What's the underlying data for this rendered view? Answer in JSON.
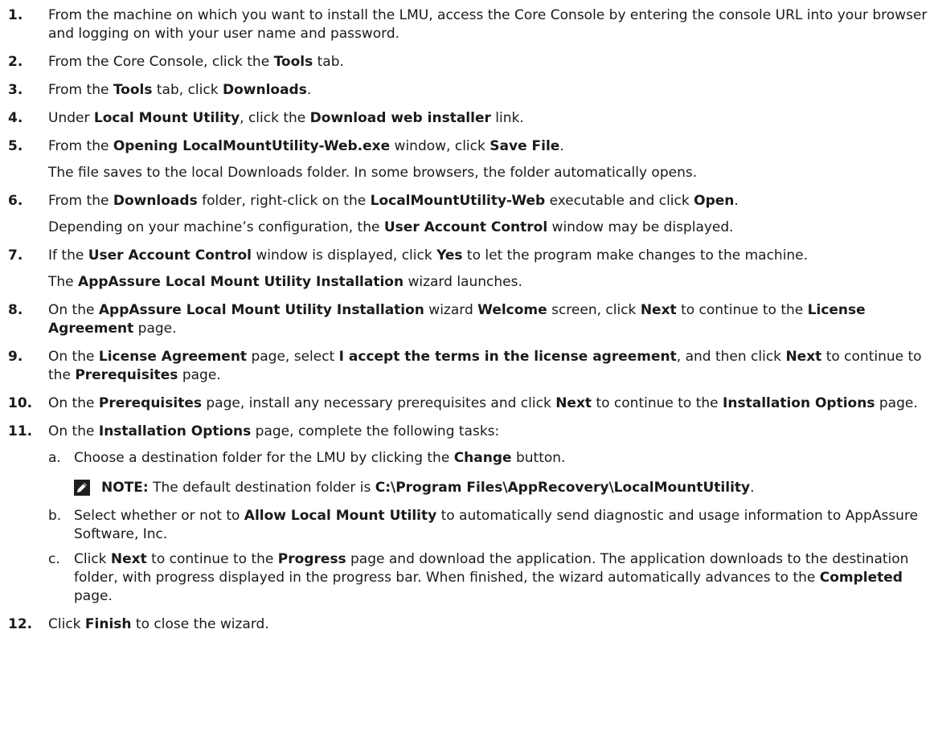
{
  "steps": [
    {
      "number": "1.",
      "parts": [
        {
          "t": "From the machine on which you want to install the LMU, access the Core Console by entering the console URL into your browser and logging on with your user name and password."
        }
      ]
    },
    {
      "number": "2.",
      "parts": [
        {
          "t": "From the Core Console, click the "
        },
        {
          "t": "Tools",
          "b": true
        },
        {
          "t": " tab."
        }
      ]
    },
    {
      "number": "3.",
      "parts": [
        {
          "t": "From the "
        },
        {
          "t": "Tools",
          "b": true
        },
        {
          "t": " tab, click "
        },
        {
          "t": "Downloads",
          "b": true
        },
        {
          "t": "."
        }
      ]
    },
    {
      "number": "4.",
      "parts": [
        {
          "t": "Under "
        },
        {
          "t": "Local Mount Utility",
          "b": true
        },
        {
          "t": ", click the "
        },
        {
          "t": "Download web installer",
          "b": true
        },
        {
          "t": " link."
        }
      ]
    },
    {
      "number": "5.",
      "parts": [
        {
          "t": "From the "
        },
        {
          "t": "Opening LocalMountUtility-Web.exe",
          "b": true
        },
        {
          "t": " window, click "
        },
        {
          "t": "Save File",
          "b": true
        },
        {
          "t": "."
        }
      ],
      "followup": [
        {
          "t": "The file saves to the local Downloads folder. In some browsers, the folder automatically opens."
        }
      ]
    },
    {
      "number": "6.",
      "parts": [
        {
          "t": "From the "
        },
        {
          "t": "Downloads",
          "b": true
        },
        {
          "t": " folder, right-click on the "
        },
        {
          "t": "LocalMountUtility-Web",
          "b": true
        },
        {
          "t": " executable and click "
        },
        {
          "t": "Open",
          "b": true
        },
        {
          "t": "."
        }
      ],
      "followup": [
        {
          "t": "Depending on your machine’s configuration, the "
        },
        {
          "t": "User Account Control",
          "b": true
        },
        {
          "t": " window may be displayed."
        }
      ]
    },
    {
      "number": "7.",
      "parts": [
        {
          "t": "If the "
        },
        {
          "t": "User Account Control",
          "b": true
        },
        {
          "t": " window is displayed, click "
        },
        {
          "t": "Yes",
          "b": true
        },
        {
          "t": " to let the program make changes to the machine."
        }
      ],
      "followup": [
        {
          "t": "The "
        },
        {
          "t": "AppAssure Local Mount Utility Installation",
          "b": true
        },
        {
          "t": " wizard launches."
        }
      ]
    },
    {
      "number": "8.",
      "parts": [
        {
          "t": "On the "
        },
        {
          "t": "AppAssure Local Mount Utility Installation",
          "b": true
        },
        {
          "t": " wizard "
        },
        {
          "t": "Welcome",
          "b": true
        },
        {
          "t": " screen, click "
        },
        {
          "t": "Next",
          "b": true
        },
        {
          "t": " to continue to the "
        },
        {
          "t": "License Agreement",
          "b": true
        },
        {
          "t": " page."
        }
      ]
    },
    {
      "number": "9.",
      "parts": [
        {
          "t": "On the "
        },
        {
          "t": "License Agreement",
          "b": true
        },
        {
          "t": " page, select "
        },
        {
          "t": "I accept the terms in the license agreement",
          "b": true
        },
        {
          "t": ", and then click "
        },
        {
          "t": "Next",
          "b": true
        },
        {
          "t": " to continue to the "
        },
        {
          "t": "Prerequisites",
          "b": true
        },
        {
          "t": " page."
        }
      ]
    },
    {
      "number": "10.",
      "parts": [
        {
          "t": "On the "
        },
        {
          "t": "Prerequisites",
          "b": true
        },
        {
          "t": " page, install any necessary prerequisites and click "
        },
        {
          "t": "Next",
          "b": true
        },
        {
          "t": " to continue to the "
        },
        {
          "t": "Installation Options",
          "b": true
        },
        {
          "t": " page."
        }
      ]
    },
    {
      "number": "11.",
      "parts": [
        {
          "t": "On the "
        },
        {
          "t": "Installation Options",
          "b": true
        },
        {
          "t": " page, complete the following tasks:"
        }
      ],
      "substeps": [
        {
          "letter": "a.",
          "parts": [
            {
              "t": "Choose a destination folder for the LMU by clicking the "
            },
            {
              "t": "Change",
              "b": true
            },
            {
              "t": " button."
            }
          ],
          "note": {
            "icon": "note-pencil-icon",
            "parts": [
              {
                "t": "NOTE:",
                "b": true
              },
              {
                "t": " The default destination folder is "
              },
              {
                "t": "C:\\Program Files\\AppRecovery\\LocalMountUtility",
                "b": true
              },
              {
                "t": "."
              }
            ]
          }
        },
        {
          "letter": "b.",
          "parts": [
            {
              "t": "Select whether or not to "
            },
            {
              "t": "Allow Local Mount Utility",
              "b": true
            },
            {
              "t": " to automatically send diagnostic and usage information to AppAssure Software, Inc."
            }
          ]
        },
        {
          "letter": "c.",
          "parts": [
            {
              "t": "Click "
            },
            {
              "t": "Next",
              "b": true
            },
            {
              "t": " to continue to the "
            },
            {
              "t": "Progress",
              "b": true
            },
            {
              "t": " page and download the application. The application downloads to the destination folder, with progress displayed in the progress bar. When finished, the wizard automatically advances to the "
            },
            {
              "t": "Completed",
              "b": true
            },
            {
              "t": " page."
            }
          ]
        }
      ]
    },
    {
      "number": "12.",
      "parts": [
        {
          "t": "Click "
        },
        {
          "t": "Finish",
          "b": true
        },
        {
          "t": " to close the wizard."
        }
      ]
    }
  ]
}
